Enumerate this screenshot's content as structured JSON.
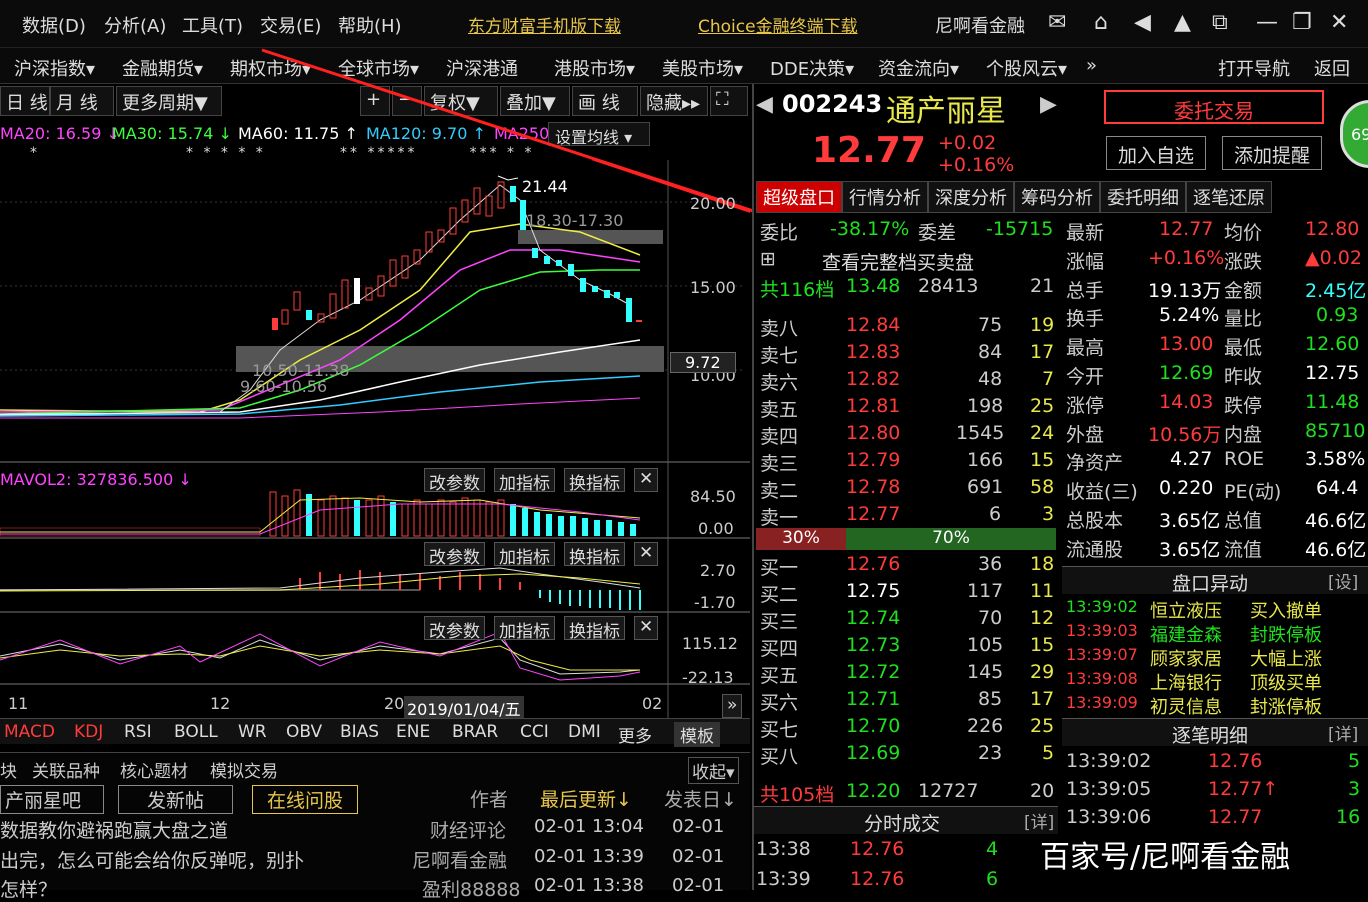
{
  "menu": {
    "items": [
      "数据(D)",
      "分析(A)",
      "工具(T)",
      "交易(E)",
      "帮助(H)"
    ],
    "ad1": "东方财富手机版下载",
    "ad2": "Choice金融终端下载",
    "user": "尼啊看金融"
  },
  "nav": {
    "items": [
      "沪深指数▾",
      "金融期货▾",
      "期权市场▾",
      "全球市场▾",
      "沪深港通",
      "港股市场▾",
      "美股市场▾",
      "DDE决策▾",
      "资金流向▾",
      "个股风云▾",
      "»"
    ],
    "open_nav": "打开导航",
    "back": "返回"
  },
  "toolbar": {
    "period1": "日 线",
    "period2": "月 线",
    "more": "更多周期▼",
    "fq": "复权▼",
    "overlay": "叠加▼",
    "draw": "画 线",
    "hide": "隐藏▸▸"
  },
  "ma": {
    "ma20": "MA20: 16.59 ↓",
    "ma30": "MA30: 15.74 ↓",
    "ma60": "MA60: 11.75 ↑",
    "ma120": "MA120: 9.70 ↑",
    "ma250": "MA250",
    "set": "设置均线 ▾"
  },
  "chart": {
    "high_label": "21.44",
    "range1": "18.30-17.30",
    "range2": "10.50-11.38",
    "range3": "9.60-10.56",
    "price_20": "20.00",
    "price_15": "15.00",
    "price_10": "10.00",
    "last_mark": "9.72",
    "vol_label": "MAVOL2: 327836.500 ↓",
    "vol_hi": "84.50",
    "vol_lo": "0.00",
    "macd_hi": "2.70",
    "macd_lo": "-1.70",
    "kdj_hi": "115.12",
    "kdj_lo": "-22.13",
    "x_11": "11",
    "x_12": "12",
    "x_date": "2019/01/04/五",
    "x_02": "02",
    "x_20": "20"
  },
  "panel_btns": {
    "param": "改参数",
    "add": "加指标",
    "swap": "换指标",
    "close": "✕"
  },
  "indicator_tabs": [
    "MACD",
    "KDJ",
    "RSI",
    "BOLL",
    "WR",
    "OBV",
    "BIAS",
    "ENE",
    "BRAR",
    "CCI",
    "DMI",
    "更多",
    "模板"
  ],
  "stock": {
    "code": "002243",
    "name": "通产丽星",
    "price": "12.77",
    "chg": "+0.02",
    "pct": "+0.16%",
    "entrust": "委托交易",
    "add_fav": "加入自选",
    "add_alert": "添加提醒",
    "score": "69"
  },
  "right_tabs": [
    "超级盘口",
    "行情分析",
    "深度分析",
    "筹码分析",
    "委托明细",
    "逐笔还原"
  ],
  "weibi": {
    "label": "委比",
    "value": "-38.17%",
    "wc_label": "委差",
    "wc_value": "-15715"
  },
  "full_order": "查看完整档买卖盘",
  "total_sell": {
    "label": "共116档",
    "price": "13.48",
    "vol": "28413",
    "n": "21"
  },
  "sells": [
    [
      "卖八",
      "12.84",
      "75",
      "19"
    ],
    [
      "卖七",
      "12.83",
      "84",
      "17"
    ],
    [
      "卖六",
      "12.82",
      "48",
      "7"
    ],
    [
      "卖五",
      "12.81",
      "198",
      "25"
    ],
    [
      "卖四",
      "12.80",
      "1545",
      "24"
    ],
    [
      "卖三",
      "12.79",
      "166",
      "15"
    ],
    [
      "卖二",
      "12.78",
      "691",
      "58"
    ],
    [
      "卖一",
      "12.77",
      "6",
      "3"
    ]
  ],
  "ratio": {
    "buy": "30%",
    "sell": "70%"
  },
  "buys": [
    [
      "买一",
      "12.76",
      "36",
      "18"
    ],
    [
      "买二",
      "12.75",
      "117",
      "11"
    ],
    [
      "买三",
      "12.74",
      "70",
      "12"
    ],
    [
      "买四",
      "12.73",
      "105",
      "15"
    ],
    [
      "买五",
      "12.72",
      "145",
      "29"
    ],
    [
      "买六",
      "12.71",
      "85",
      "17"
    ],
    [
      "买七",
      "12.70",
      "226",
      "25"
    ],
    [
      "买八",
      "12.69",
      "23",
      "5"
    ]
  ],
  "total_buy": {
    "label": "共105档",
    "price": "12.20",
    "vol": "12727",
    "n": "20"
  },
  "stats": [
    [
      "最新",
      "12.77",
      "均价",
      "12.80"
    ],
    [
      "涨幅",
      "+0.16%",
      "涨跌",
      "▲0.02"
    ],
    [
      "总手",
      "19.13万",
      "金额",
      "2.45亿"
    ],
    [
      "换手",
      "5.24%",
      "量比",
      "0.93"
    ],
    [
      "最高",
      "13.00",
      "最低",
      "12.60"
    ],
    [
      "今开",
      "12.69",
      "昨收",
      "12.75"
    ],
    [
      "涨停",
      "14.03",
      "跌停",
      "11.48"
    ],
    [
      "外盘",
      "10.56万",
      "内盘",
      "85710"
    ],
    [
      "净资产",
      "4.27",
      "ROE",
      "3.58%"
    ],
    [
      "收益(三)",
      "0.220",
      "PE(动)",
      "64.4"
    ],
    [
      "总股本",
      "3.65亿",
      "总值",
      "46.6亿"
    ],
    [
      "流通股",
      "3.65亿",
      "流值",
      "46.6亿"
    ]
  ],
  "anomaly": {
    "title": "盘口异动",
    "set": "[设]",
    "rows": [
      [
        "13:39:02",
        "恒立液压",
        "买入撤单"
      ],
      [
        "13:39:03",
        "福建金森",
        "封跌停板"
      ],
      [
        "13:39:07",
        "顾家家居",
        "大幅上涨"
      ],
      [
        "13:39:08",
        "上海银行",
        "顶级买单"
      ],
      [
        "13:39:09",
        "初灵信息",
        "封涨停板"
      ]
    ]
  },
  "ticks": {
    "title": "逐笔明细",
    "detail": "[详]",
    "rows": [
      [
        "13:39:02",
        "12.76",
        "5"
      ],
      [
        "13:39:05",
        "12.77↑",
        "3"
      ],
      [
        "13:39:06",
        "12.77",
        "16"
      ]
    ]
  },
  "fenshi": {
    "title": "分时成交",
    "detail": "[详]",
    "rows": [
      [
        "13:38",
        "12.76",
        "4"
      ],
      [
        "13:39",
        "12.76",
        "6"
      ]
    ]
  },
  "forum": {
    "tabs": [
      "块",
      "关联品种",
      "核心题材",
      "模拟交易"
    ],
    "collapse": "收起▾",
    "bar": "产丽星吧",
    "post": "发新帖",
    "ask": "在线问股",
    "author": "作者",
    "last_update": "最后更新↓",
    "post_date": "发表日↓",
    "rows": [
      [
        "数据教你避祸跑赢大盘之道",
        "财经评论",
        "02-01 13:04",
        "02-01"
      ],
      [
        "出完，怎么可能会给你反弹呢，别扑",
        "尼啊看金融",
        "02-01 13:39",
        "02-01"
      ],
      [
        "怎样？",
        "盈利88888",
        "02-01 13:38",
        "02-01"
      ]
    ]
  },
  "watermark": "百家号/尼啊看金融"
}
